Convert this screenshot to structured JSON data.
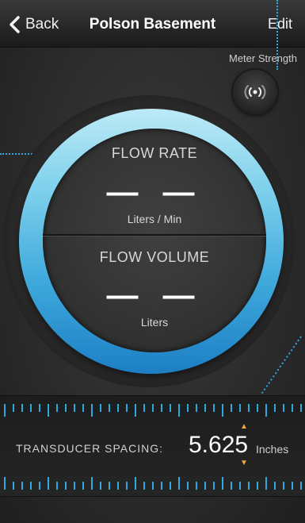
{
  "nav": {
    "back_label": "Back",
    "title": "Polson Basement",
    "edit_label": "Edit"
  },
  "meter_strength": {
    "label": "Meter Strength",
    "icon": "signal-broadcast-icon"
  },
  "gauge": {
    "flow_rate": {
      "title": "FLOW  RATE",
      "value": "— —",
      "unit": "Liters / Min"
    },
    "flow_volume": {
      "title": "FLOW VOLUME",
      "value": "— —",
      "unit": "Liters"
    },
    "ring_colors": [
      "#bdeaf7",
      "#3fa9dc",
      "#1c7fc4"
    ]
  },
  "transducer": {
    "label": "TRANSDUCER SPACING:",
    "value": "5.625",
    "unit": "Inches",
    "up_icon": "arrow-up-icon",
    "down_icon": "arrow-down-icon"
  },
  "colors": {
    "accent": "#2fa8e0",
    "arrow": "#f3a63a"
  }
}
